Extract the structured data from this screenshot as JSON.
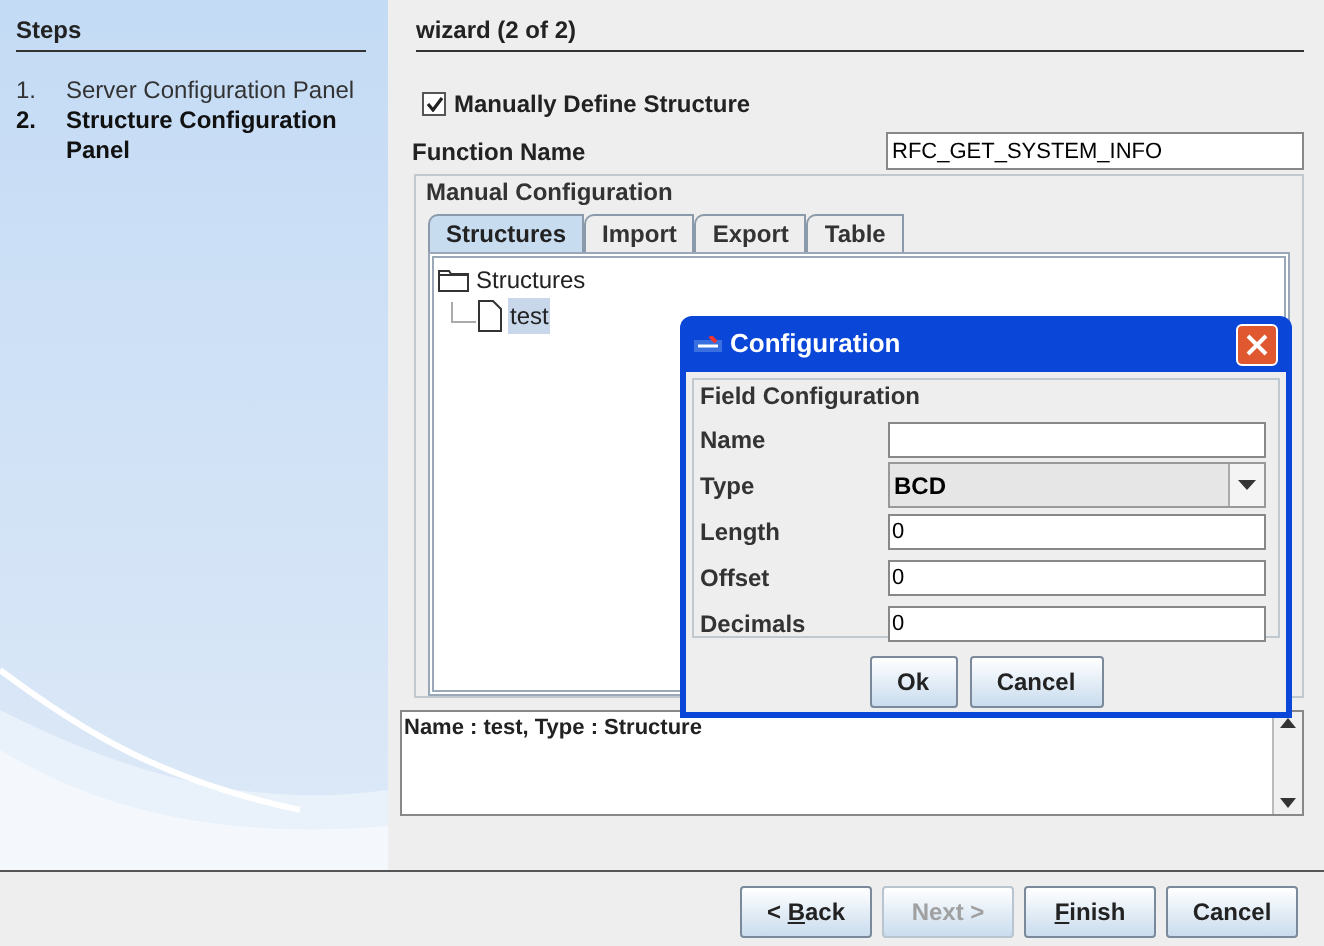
{
  "sidebar": {
    "title": "Steps",
    "steps": [
      {
        "number": "1.",
        "label": "Server Configuration Panel",
        "selected": false
      },
      {
        "number": "2.",
        "label": "Structure Configuration Panel",
        "selected": true
      }
    ]
  },
  "main": {
    "title": "wizard (2 of 2)",
    "manual_checkbox": {
      "label": "Manually Define Structure",
      "checked": true
    },
    "function_name": {
      "label": "Function Name",
      "value": "RFC_GET_SYSTEM_INFO"
    },
    "group_title": "Manual Configuration",
    "tabs": [
      {
        "label": "Structures",
        "selected": true
      },
      {
        "label": "Import",
        "selected": false
      },
      {
        "label": "Export",
        "selected": false
      },
      {
        "label": "Table",
        "selected": false
      }
    ],
    "tree": {
      "label": "Structures",
      "children": [
        {
          "label": "test",
          "selected": true
        }
      ]
    },
    "details": "Name : test, Type : Structure"
  },
  "dialog": {
    "title": "Configuration",
    "group_title": "Field Configuration",
    "fields": [
      {
        "kind": "text",
        "label": "Name"
      },
      {
        "kind": "combo",
        "label": "Type",
        "value": "BCD"
      },
      {
        "kind": "text",
        "label": "Length",
        "value": "0"
      },
      {
        "kind": "text",
        "label": "Offset",
        "value": "0"
      },
      {
        "kind": "text",
        "label": "Decimals",
        "value": "0"
      }
    ],
    "buttons": [
      {
        "parts": [
          {
            "text": "Ok",
            "underline": false
          }
        ]
      },
      {
        "parts": [
          {
            "text": "Cancel",
            "underline": false
          }
        ]
      }
    ]
  },
  "footer_buttons": [
    {
      "disabled": false,
      "parts": [
        {
          "text": "< ",
          "underline": false
        },
        {
          "text": "B",
          "underline": true
        },
        {
          "text": "ack",
          "underline": false
        }
      ]
    },
    {
      "disabled": true,
      "parts": [
        {
          "text": "Next >",
          "underline": false
        }
      ]
    },
    {
      "disabled": false,
      "parts": [
        {
          "text": "F",
          "underline": true
        },
        {
          "text": "inish",
          "underline": false
        }
      ]
    },
    {
      "disabled": false,
      "parts": [
        {
          "text": "Cancel",
          "underline": false
        }
      ]
    }
  ]
}
